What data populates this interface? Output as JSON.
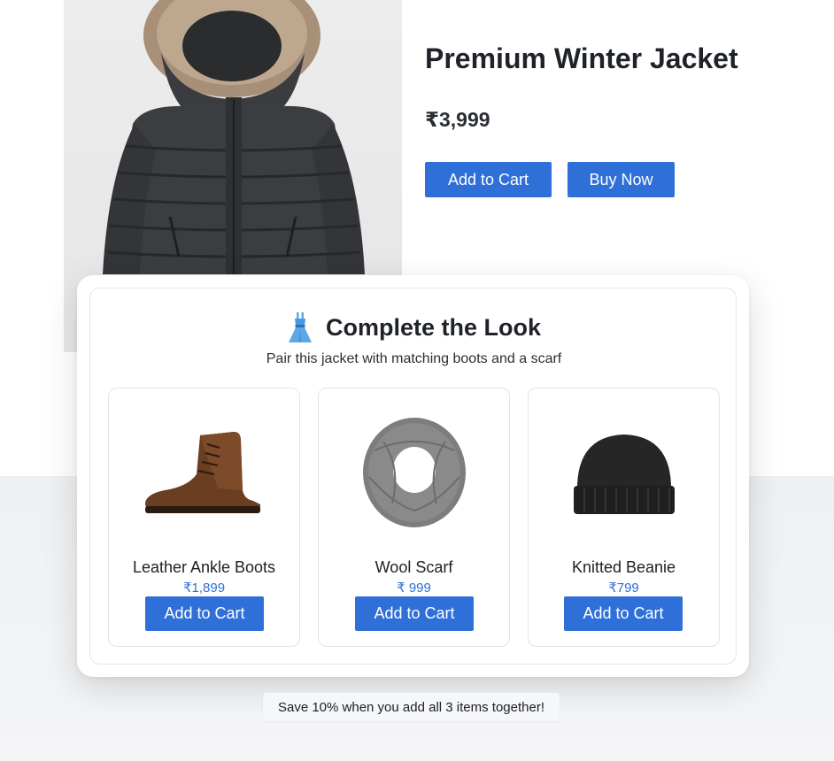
{
  "product": {
    "title": "Premium Winter Jacket",
    "price": "₹3,999",
    "add_to_cart_label": "Add to Cart",
    "buy_now_label": "Buy Now",
    "image_icon": "puffer-jacket-photo"
  },
  "complete_the_look": {
    "title_icon": "dress-icon",
    "title": "Complete the Look",
    "subtitle": "Pair this jacket with matching boots and a scarf",
    "items": [
      {
        "name": "Leather Ankle Boots",
        "price": "₹1,899",
        "button_label": "Add to Cart",
        "icon": "ankle-boot-photo"
      },
      {
        "name": "Wool Scarf",
        "price": "₹ 999",
        "button_label": "Add to Cart",
        "icon": "scarf-photo"
      },
      {
        "name": "Knitted Beanie",
        "price": "₹799",
        "button_label": "Add to Cart",
        "icon": "beanie-photo"
      }
    ]
  },
  "promo": {
    "text": "Save 10% when you add all 3 items together!"
  },
  "colors": {
    "accent": "#2f6fd8",
    "page_bottom": "#eef0f2",
    "text": "#202124"
  }
}
